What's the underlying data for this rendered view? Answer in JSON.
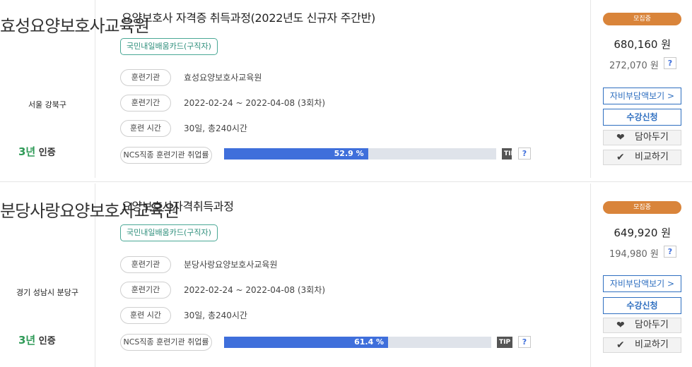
{
  "courses": [
    {
      "institution": "효성요양보호사교육원",
      "region": "서울 강북구",
      "cert_num": "3년",
      "cert_text": " 인증",
      "title": "요양보호사 자격증 취득과정(2022년도 신규자 주간반)",
      "card_type": "국민내일배움카드(구직자)",
      "rows": [
        {
          "label": "훈련기관",
          "value": "효성요양보호사교육원"
        },
        {
          "label": "훈련기간",
          "value": "2022-02-24 ~ 2022-04-08 (3회차)"
        },
        {
          "label": "훈련 시간",
          "value": "30일, 총240시간"
        }
      ],
      "employment_label": "NCS직종 훈련기관 취업률",
      "employment_rate": 52.9,
      "employment_text": "52.9 %",
      "tip": "TIP",
      "help": "?",
      "status": "모집중",
      "price": "680,160 원",
      "self_pay": "272,070 원",
      "btn_selfpay": "자비부담액보기 >",
      "btn_apply": "수강신청",
      "btn_wish": "담아두기",
      "btn_compare": "비교하기"
    },
    {
      "institution": "분당사랑요양보호사교육원",
      "region": "경기 성남시 분당구",
      "cert_num": "3년",
      "cert_text": " 인증",
      "title": "요양보호사자격취득과정",
      "card_type": "국민내일배움카드(구직자)",
      "rows": [
        {
          "label": "훈련기관",
          "value": "분당사랑요양보호사교육원"
        },
        {
          "label": "훈련기간",
          "value": "2022-02-24 ~ 2022-04-08 (3회차)"
        },
        {
          "label": "훈련 시간",
          "value": "30일, 총240시간"
        }
      ],
      "employment_label": "NCS직종 훈련기관 취업률",
      "employment_rate": 61.4,
      "employment_text": "61.4 %",
      "tip": "TIP",
      "help": "?",
      "status": "모집중",
      "price": "649,920 원",
      "self_pay": "194,980 원",
      "btn_selfpay": "자비부담액보기 >",
      "btn_apply": "수강신청",
      "btn_wish": "담아두기",
      "btn_compare": "비교하기"
    }
  ],
  "colors": {
    "accent": "#3f6fdb",
    "status": "#d9843a",
    "card_tag": "#4aa896",
    "button": "#2f6fc0"
  },
  "icons": {
    "wish": "heart-icon",
    "compare": "check-icon"
  }
}
